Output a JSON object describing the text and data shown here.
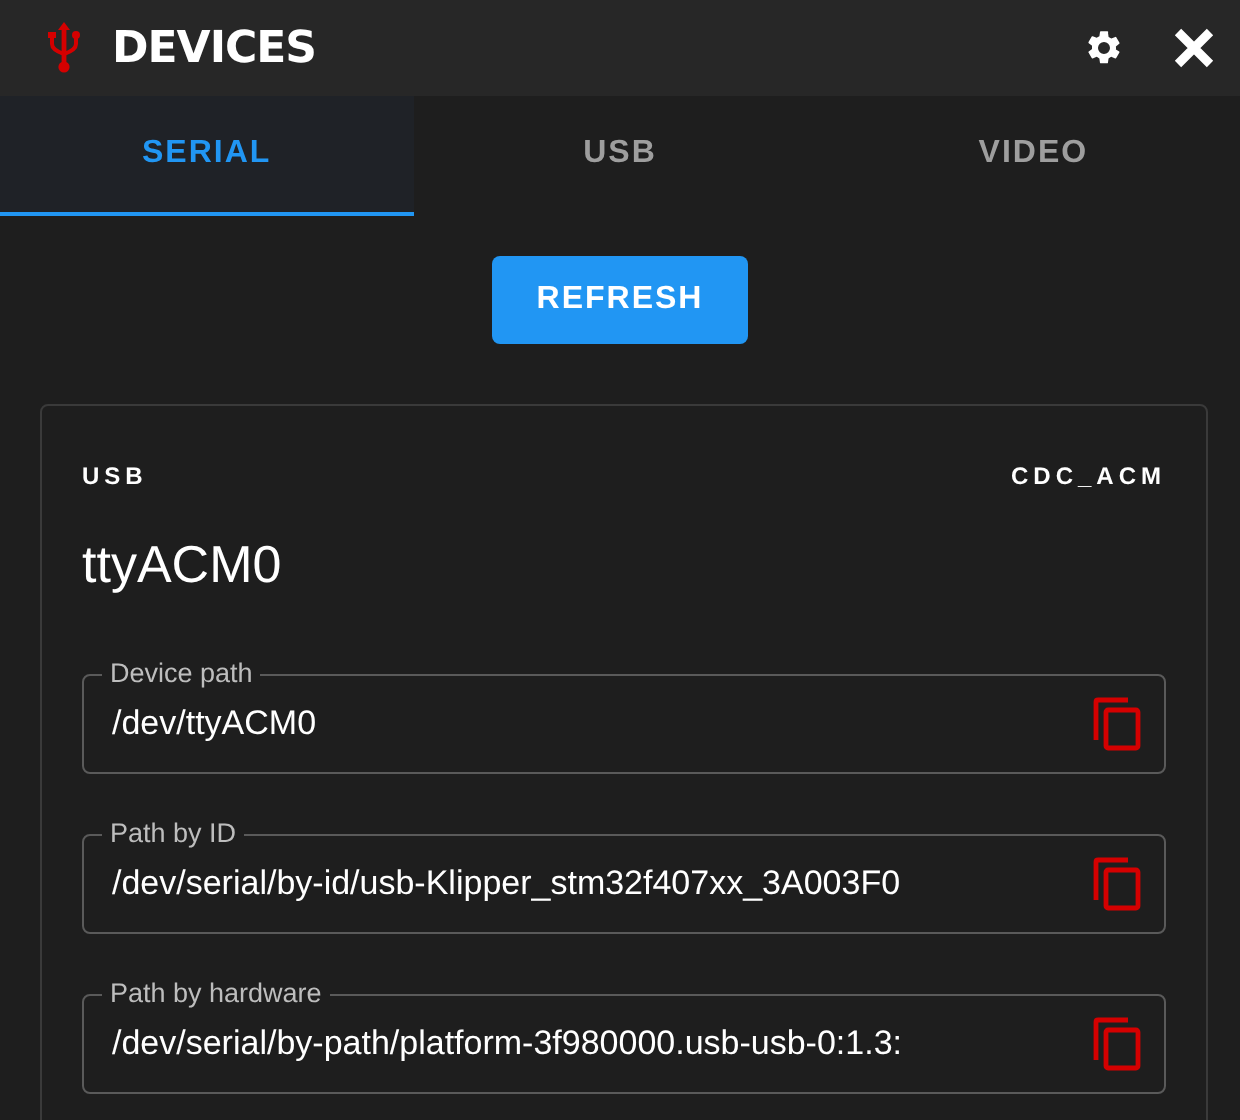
{
  "header": {
    "title": "DEVICES"
  },
  "tabs": [
    {
      "label": "SERIAL",
      "selected": true
    },
    {
      "label": "USB",
      "selected": false
    },
    {
      "label": "VIDEO",
      "selected": false
    }
  ],
  "refresh_button": "REFRESH",
  "device": {
    "bus": "USB",
    "driver": "CDC_ACM",
    "name": "ttyACM0",
    "fields": [
      {
        "label": "Device path",
        "value": "/dev/ttyACM0"
      },
      {
        "label": "Path by ID",
        "value": "/dev/serial/by-id/usb-Klipper_stm32f407xx_3A003F0"
      },
      {
        "label": "Path by hardware",
        "value": "/dev/serial/by-path/platform-3f980000.usb-usb-0:1.3:"
      }
    ]
  }
}
